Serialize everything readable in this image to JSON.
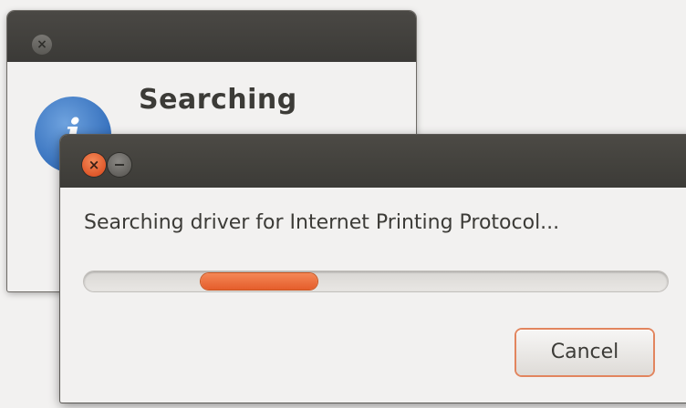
{
  "background_dialog": {
    "title": "Searching",
    "close_glyph": "×",
    "icon": "info-icon",
    "icon_glyph": "i"
  },
  "progress_dialog": {
    "close_glyph": "×",
    "message": "Searching driver for Internet Printing Protocol...",
    "progress": {
      "mode": "indeterminate",
      "pulse_start": 0.2,
      "pulse_end": 0.4
    },
    "cancel_label": "Cancel"
  },
  "colors": {
    "accent": "#e55d2b",
    "titlebar": "#3c3b37",
    "window_bg": "#f2f1f0",
    "text": "#3c3b37"
  }
}
